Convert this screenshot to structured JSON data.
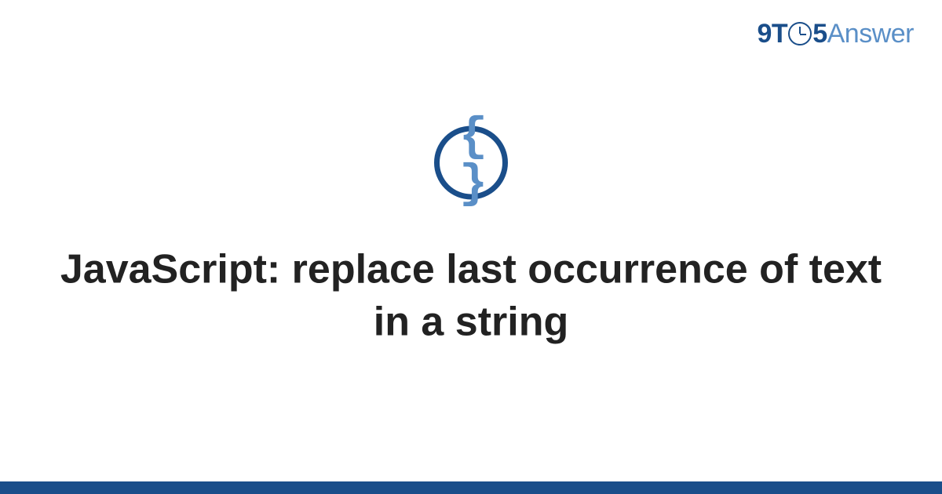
{
  "logo": {
    "nine": "9",
    "t": "T",
    "five": "5",
    "answer": "Answer"
  },
  "icon": {
    "name": "code-braces-icon",
    "glyph": "{ }"
  },
  "title": "JavaScript: replace last occurrence of text in a string",
  "colors": {
    "brand_dark": "#1a4e8a",
    "brand_light": "#5a8fc7",
    "text": "#222222",
    "background": "#ffffff"
  }
}
